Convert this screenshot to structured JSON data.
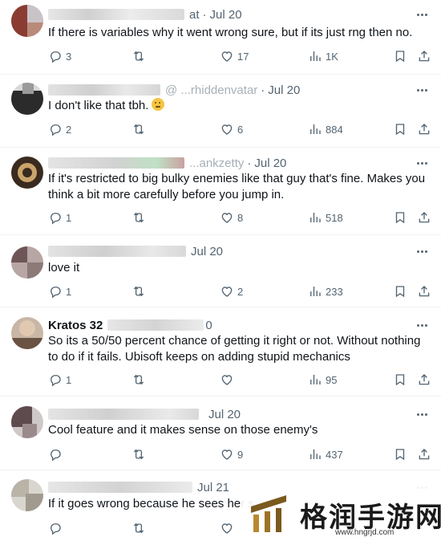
{
  "tweets": [
    {
      "handle": "at",
      "date": "Jul 20",
      "text": "If there is variables why it went wrong sure, but if its just rng then no.",
      "replies": "3",
      "retweets": "",
      "likes": "17",
      "views": "1K"
    },
    {
      "handle": "@ ...rhiddenvatar",
      "date": "Jul 20",
      "text": "I don't like that tbh.",
      "replies": "2",
      "retweets": "",
      "likes": "6",
      "views": "884"
    },
    {
      "handle": "...ankzetty",
      "date": "Jul 20",
      "text": "If it's restricted to big bulky enemies like that guy that's fine. Makes you think a bit more carefully before you jump in.",
      "replies": "1",
      "retweets": "",
      "likes": "8",
      "views": "518"
    },
    {
      "handle": "",
      "date": "Jul 20",
      "text": "love it",
      "replies": "1",
      "retweets": "",
      "likes": "2",
      "views": "233"
    },
    {
      "name": "Kratos 32",
      "handle": "",
      "date": "0",
      "text": "So its a 50/50 percent chance of getting it right or not. Without nothing to do if it fails. Ubisoft keeps on adding stupid mechanics",
      "replies": "1",
      "retweets": "",
      "likes": "",
      "views": "95"
    },
    {
      "handle": "",
      "date": "Jul 20",
      "text": "Cool feature and it makes sense on those enemy's",
      "replies": "",
      "retweets": "",
      "likes": "9",
      "views": "437"
    },
    {
      "handle": "",
      "date": "Jul 21",
      "text": "If it goes wrong because he sees her s",
      "replies": "",
      "retweets": "",
      "likes": "",
      "views": ""
    }
  ],
  "watermark": {
    "title": "格润手游网",
    "url": "www.hngrjd.com"
  }
}
